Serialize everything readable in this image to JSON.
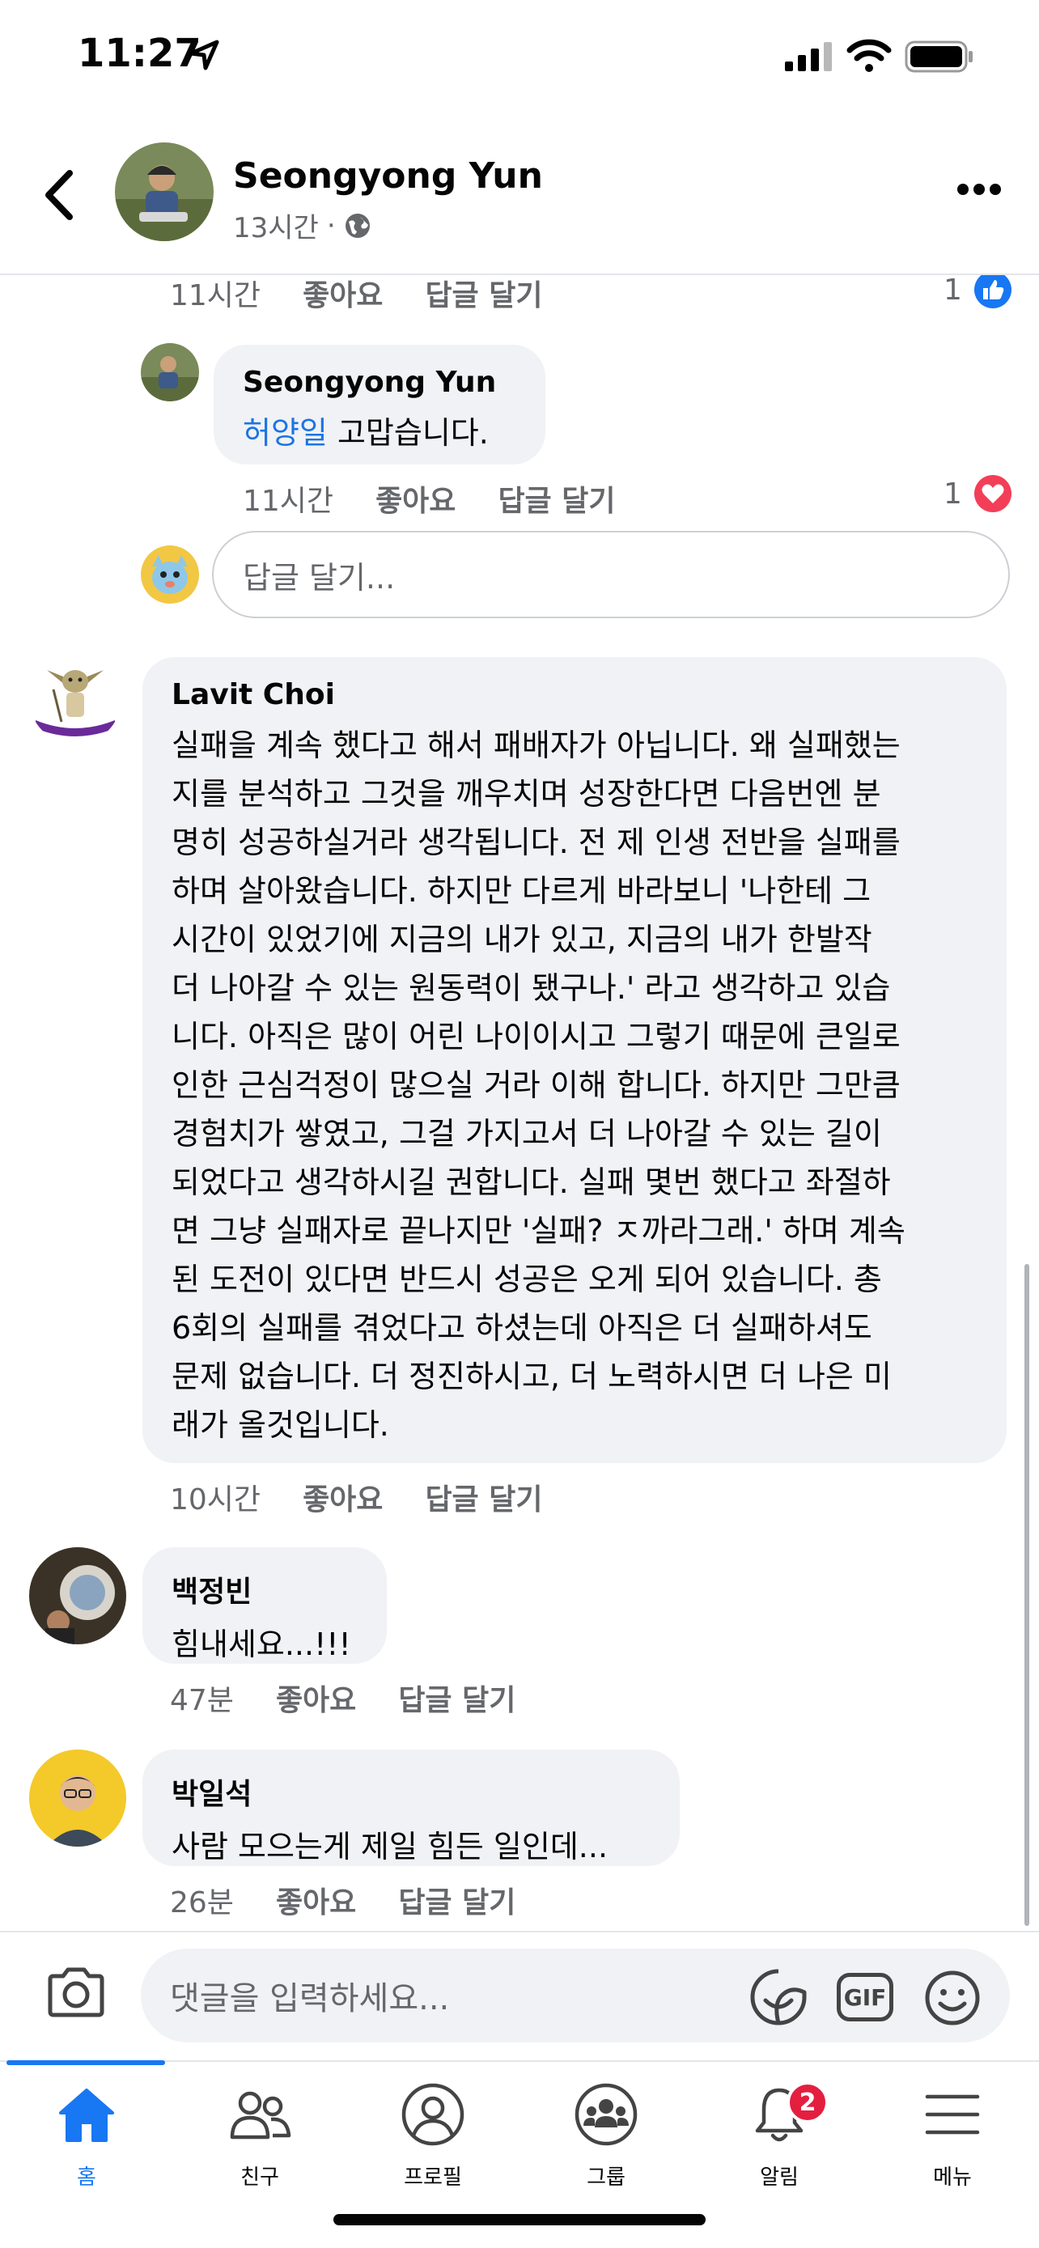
{
  "status_bar": {
    "time": "11:27"
  },
  "header": {
    "name": "Seongyong Yun",
    "time": "13시간",
    "separator": "·"
  },
  "comments": [
    {
      "id": "c0",
      "time": "11시간",
      "like": "좋아요",
      "reply": "답글 달기",
      "reaction_count": "1",
      "reaction": "like"
    },
    {
      "id": "c1",
      "author": "Seongyong Yun",
      "mention": "허양일",
      "text": " 고맙습니다.",
      "time": "11시간",
      "like": "좋아요",
      "reply": "답글 달기",
      "reaction_count": "1",
      "reaction": "love"
    },
    {
      "id": "c2",
      "author": "Lavit Choi",
      "lines": [
        "실패을 계속 했다고 해서 패배자가 아닙니다. 왜 실패했는",
        "지를 분석하고 그것을 깨우치며 성장한다면 다음번엔 분",
        "명히 성공하실거라 생각됩니다. 전 제 인생 전반을 실패를",
        "하며 살아왔습니다. 하지만 다르게 바라보니 '나한테 그",
        "시간이 있었기에 지금의 내가 있고, 지금의 내가 한발작",
        "더 나아갈 수 있는 원동력이 됐구나.' 라고 생각하고 있습",
        "니다. 아직은 많이 어린 나이이시고 그렇기 때문에 큰일로",
        "인한 근심걱정이 많으실 거라 이해 합니다. 하지만 그만큼",
        "경험치가 쌓였고, 그걸 가지고서 더 나아갈 수 있는 길이",
        "되었다고 생각하시길 권합니다. 실패 몇번 했다고 좌절하",
        "면 그냥 실패자로 끝나지만 '실패? ㅈ까라그래.' 하며 계속",
        "된 도전이 있다면 반드시 성공은 오게 되어 있습니다. 총",
        "6회의 실패를 겪었다고 하셨는데 아직은 더 실패하셔도",
        "문제 없습니다. 더 정진하시고, 더 노력하시면 더 나은 미",
        "래가 올것입니다."
      ],
      "time": "10시간",
      "like": "좋아요",
      "reply": "답글 달기"
    },
    {
      "id": "c3",
      "author": "백정빈",
      "text": "힘내세요...!!!",
      "time": "47분",
      "like": "좋아요",
      "reply": "답글 달기"
    },
    {
      "id": "c4",
      "author": "박일석",
      "text": "사람 모으는게 제일 힘든 일인데...",
      "time": "26분",
      "like": "좋아요",
      "reply": "답글 달기"
    }
  ],
  "reply_input": {
    "placeholder": "답글 달기..."
  },
  "composer": {
    "placeholder": "댓글을 입력하세요...",
    "gif": "GIF"
  },
  "tabs": [
    {
      "label": "홈",
      "icon": "home-icon",
      "active": true
    },
    {
      "label": "친구",
      "icon": "friends-icon"
    },
    {
      "label": "프로필",
      "icon": "profile-icon"
    },
    {
      "label": "그룹",
      "icon": "groups-icon"
    },
    {
      "label": "알림",
      "icon": "bell-icon",
      "badge": "2"
    },
    {
      "label": "메뉴",
      "icon": "menu-icon"
    }
  ],
  "colors": {
    "accent": "#1877f2",
    "mention": "#1b74e4",
    "bubble": "#f0f2f5",
    "badge": "#e41e3f",
    "love": "#f33e58"
  }
}
